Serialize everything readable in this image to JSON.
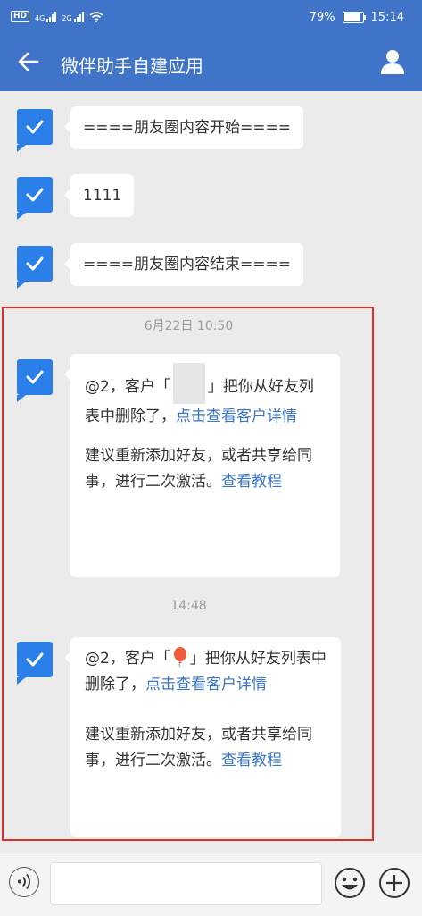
{
  "status": {
    "signal1": "4G",
    "signal2": "2G",
    "battery": "79%",
    "time": "15:14",
    "badge": "HD"
  },
  "header": {
    "title": "微伴助手自建应用"
  },
  "messages": {
    "m1": "====朋友圈内容开始====",
    "m2": "1111",
    "m3": "====朋友圈内容结束===="
  },
  "times": {
    "t1": "6月22日  10:50",
    "t2": "14:48"
  },
  "notice1": {
    "part1": "@2，客户「",
    "part2": "」把你从好友列表中删除了，",
    "link": "点击查看客户详情",
    "advice": "建议重新添加好友，或者共享给同事，进行二次激活。",
    "advice_link": "查看教程"
  },
  "notice2": {
    "part1": "@2，客户「",
    "part2": "」把你从好友列表中删除了，",
    "link": "点击查看客户详情",
    "advice": "建议重新添加好友，或者共享给同事，进行二次激活。",
    "advice_link": "查看教程"
  },
  "colors": {
    "header": "#3f74c9",
    "avatar": "#2a80e8",
    "link": "#3a75c4",
    "highlight": "#e12b2b"
  }
}
